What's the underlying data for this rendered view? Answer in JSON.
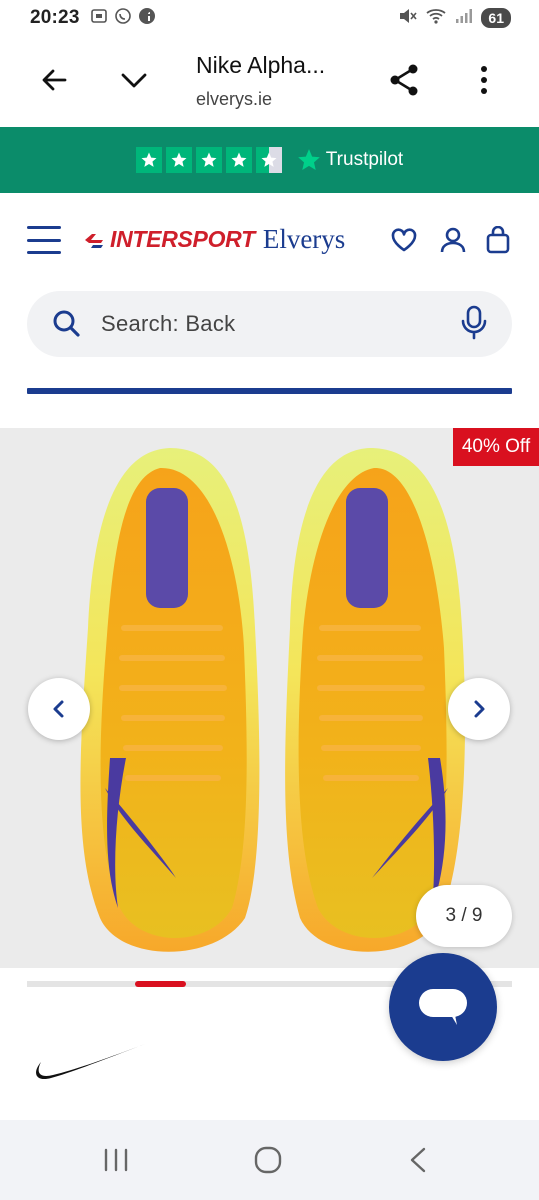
{
  "status_bar": {
    "time": "20:23",
    "battery": "61",
    "left_icons": [
      "screenshot-icon",
      "whatsapp-icon",
      "facebook-icon"
    ],
    "right_icons": [
      "mute-icon",
      "wifi-icon",
      "signal-icon"
    ]
  },
  "browser": {
    "title": "Nike Alpha...",
    "url": "elverys.ie",
    "back_icon": "arrow-left-icon",
    "collapse_icon": "chevron-down-icon",
    "share_icon": "share-icon",
    "menu_icon": "more-vertical-icon"
  },
  "trustpilot": {
    "stars": 4.5,
    "label": "Trustpilot",
    "background": "#0b8c6a",
    "star_color": "#00b67a"
  },
  "site_header": {
    "logo_brand": "INTERSPORT",
    "logo_store": "Elverys",
    "icons": [
      "menu-icon",
      "heart-icon",
      "account-icon",
      "bag-icon"
    ]
  },
  "search": {
    "placeholder": "Search: Back",
    "icons": [
      "search-icon",
      "microphone-icon"
    ]
  },
  "gallery": {
    "badge": "40% Off",
    "counter": "3 / 9",
    "current_index": 3,
    "total": 9,
    "prev_icon": "chevron-left-icon",
    "next_icon": "chevron-right-icon"
  },
  "colors": {
    "brand_blue": "#1b3c8f",
    "brand_red": "#d9101f"
  },
  "chat": {
    "icon": "chat-bubble-icon"
  },
  "brand": {
    "logo": "nike-swoosh-logo"
  },
  "android_nav": {
    "icons": [
      "recent-apps-icon",
      "home-icon",
      "back-icon"
    ]
  }
}
